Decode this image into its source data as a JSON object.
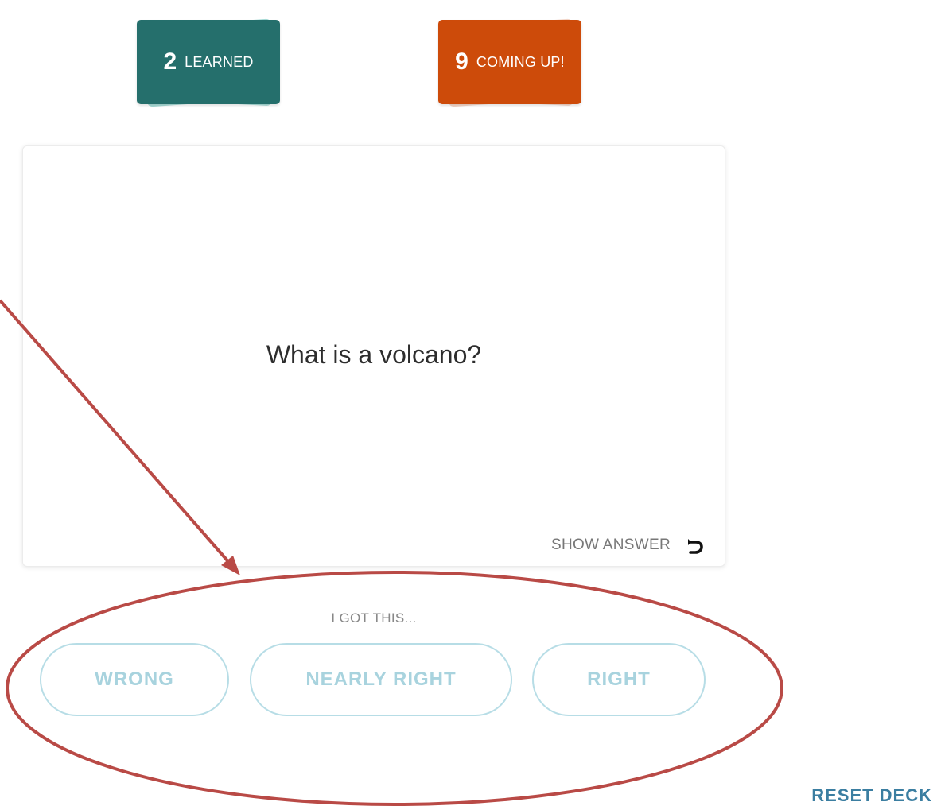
{
  "stats": {
    "learned": {
      "count": "2",
      "label": "LEARNED"
    },
    "coming_up": {
      "count": "9",
      "label": "COMING UP!"
    }
  },
  "card": {
    "question": "What is a volcano?",
    "show_answer_label": "SHOW ANSWER"
  },
  "rating": {
    "prompt": "I GOT THIS...",
    "buttons": {
      "wrong": "WRONG",
      "nearly_right": "NEARLY RIGHT",
      "right": "RIGHT"
    }
  },
  "reset_deck_label": "RESET DECK",
  "colors": {
    "learned": "#256f6c",
    "coming_up": "#cd4b0a",
    "rating_border": "#b7dde6",
    "rating_text": "#a8d3de",
    "reset_link": "#3b7ea1",
    "annotation": "#b94a46"
  },
  "icons": {
    "show_answer": "flip-arrow-icon"
  }
}
